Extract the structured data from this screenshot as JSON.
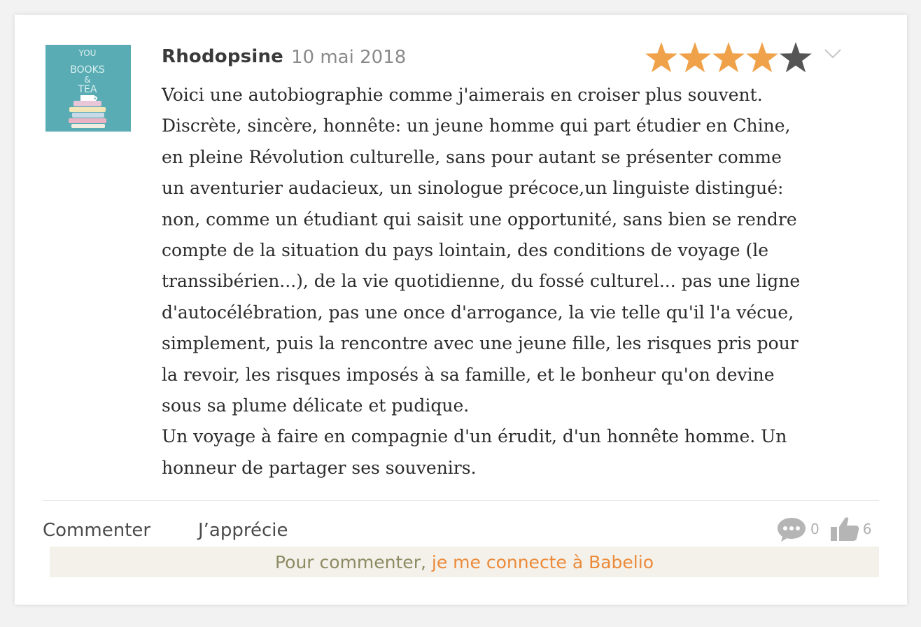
{
  "review": {
    "author": "Rhodopsine",
    "date": "10 mai 2018",
    "rating": 4,
    "max_rating": 5,
    "lines": [
      "Voici une autobiographie comme j'aimerais en croiser plus souvent.",
      "Discrète, sincère, honnête: un jeune homme qui part étudier en Chine,",
      "en pleine Révolution culturelle, sans pour autant se présenter comme",
      "un aventurier audacieux, un sinologue précoce,un linguiste distingué:",
      "non, comme un étudiant qui saisit une opportunité, sans bien se rendre",
      "compte de la situation du pays lointain, des conditions de voyage (le",
      "transsibérien...), de la vie quotidienne, du fossé culturel... pas une ligne",
      "d'autocélébration, pas une once d'arrogance, la vie telle qu'il l'a vécue,",
      "simplement, puis la rencontre avec une jeune fille, les risques pris pour",
      "la revoir, les risques imposés à sa famille, et le bonheur qu'on devine",
      "sous sa plume délicate et pudique.",
      "Un voyage à faire en compagnie d'un érudit, d'un honnête homme. Un",
      "honneur de partager ses souvenirs."
    ]
  },
  "avatar": {
    "text": [
      "YOU",
      "BOOKS",
      "&",
      "TEA"
    ],
    "color": "#5aacb4"
  },
  "actions": {
    "comment_label": "Commenter",
    "like_label": "J’apprécie",
    "comment_count": "0",
    "like_count": "6"
  },
  "login_bar": {
    "prefix": "Pour commenter, ",
    "link": "je me connecte à Babelio"
  },
  "colors": {
    "star_filled": "#f0a24a",
    "star_empty": "#555555",
    "link": "#ec8a3a",
    "login_text": "#8e8a63",
    "login_bg": "#f3f1ea"
  }
}
